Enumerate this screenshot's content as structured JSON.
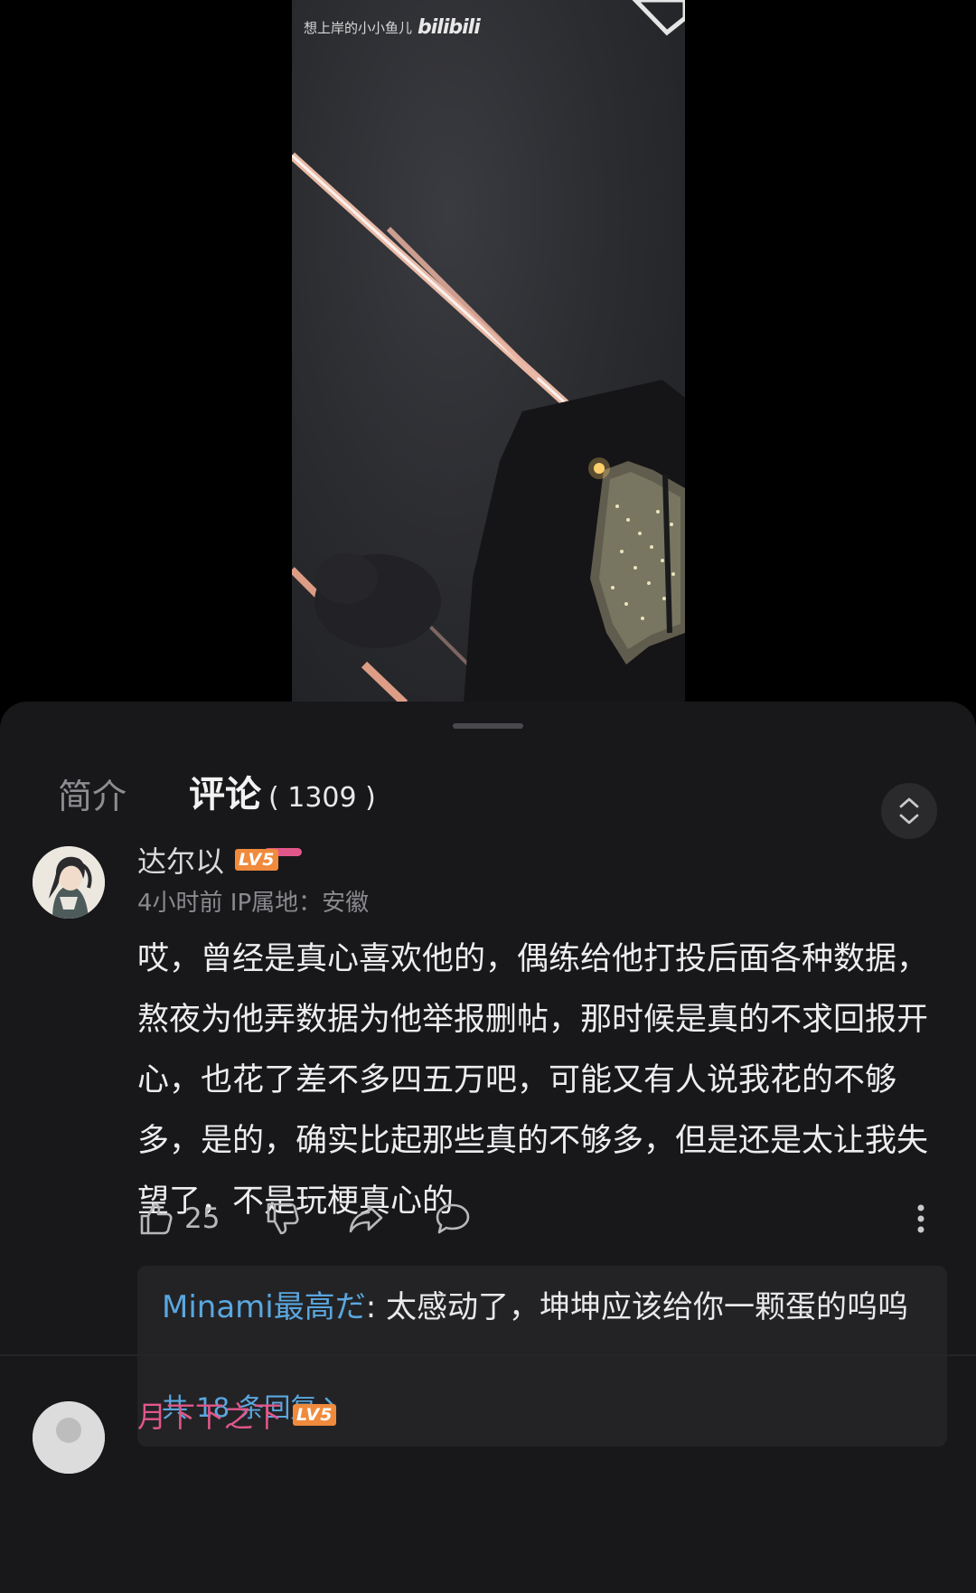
{
  "video": {
    "watermark_text": "想上岸的小小鱼儿",
    "watermark_logo": "bilibili"
  },
  "tabs": {
    "intro_label": "简介",
    "comments_label": "评论",
    "comments_count": "( 1309 )"
  },
  "comment": {
    "username": "达尔以",
    "level": "LV5",
    "meta": "4小时前 IP属地：安徽",
    "text": "哎，曾经是真心喜欢他的，偶练给他打投后面各种数据，熬夜为他弄数据为他举报删帖，那时候是真的不求回报开心，也花了差不多四五万吧，可能又有人说我花的不够多，是的，确实比起那些真的不够多，但是还是太让我失望了，不是玩梗真心的",
    "likes": "25",
    "reply_preview": {
      "author": "Minami最高だ",
      "separator": ": ",
      "text": "太感动了，坤坤应该给你一颗蛋的呜呜",
      "count_label": "共 18 条回复"
    }
  },
  "next_comment": {
    "username": "月下下之下",
    "level": "LV5"
  },
  "colors": {
    "accent_pink": "#e25789",
    "link_blue": "#5aa7de",
    "level_orange": "#f08a3c",
    "sheet_bg": "#18181a"
  }
}
